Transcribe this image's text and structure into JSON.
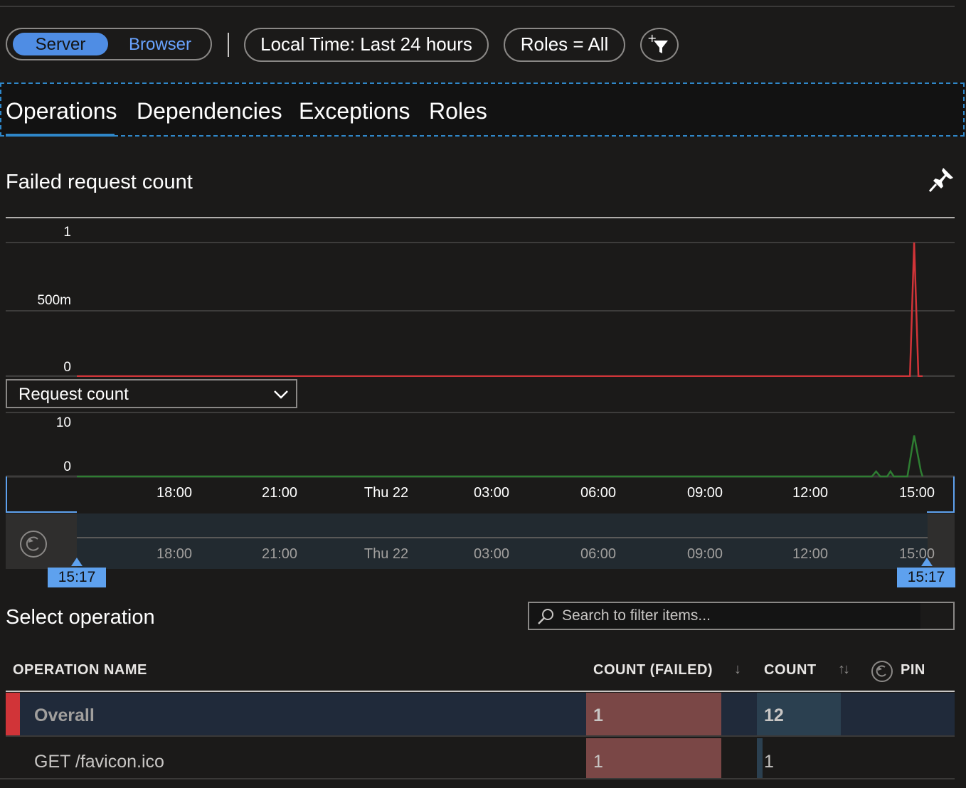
{
  "toolbar": {
    "toggle_active": "Server",
    "toggle_inactive": "Browser",
    "time_filter": "Local Time: Last 24 hours",
    "roles_filter": "Roles = All",
    "add_filter_icon": "add-filter-icon"
  },
  "tabs": [
    {
      "label": "Operations",
      "active": true
    },
    {
      "label": "Dependencies",
      "active": false
    },
    {
      "label": "Exceptions",
      "active": false
    },
    {
      "label": "Roles",
      "active": false
    }
  ],
  "failed_chart": {
    "title": "Failed request count",
    "pin_icon": "pin-icon",
    "line_color": "#d13438"
  },
  "request_chart": {
    "metric_select": "Request count",
    "line_color": "#2e7d32"
  },
  "x_ticks": [
    "18:00",
    "21:00",
    "Thu 22",
    "03:00",
    "06:00",
    "09:00",
    "12:00",
    "15:00"
  ],
  "range": {
    "start_label": "15:17",
    "end_label": "15:17",
    "reset_icon": "reset-zoom-icon"
  },
  "operations": {
    "title": "Select operation",
    "search_placeholder": "Search to filter items...",
    "columns": {
      "name": "OPERATION NAME",
      "count_failed": "COUNT (FAILED)",
      "count": "COUNT",
      "pin": "PIN"
    },
    "rows": [
      {
        "name": "Overall",
        "count_failed": "1",
        "count": "12",
        "failed_fraction": 1.0,
        "count_fraction": 1.0
      },
      {
        "name": "GET /favicon.ico",
        "count_failed": "1",
        "count": "1",
        "failed_fraction": 1.0,
        "count_fraction": 0.083
      }
    ]
  },
  "chart_data": [
    {
      "type": "line",
      "title": "Failed request count",
      "y_ticks": [
        "1",
        "500m",
        "0"
      ],
      "ylim": [
        0,
        1
      ],
      "x_ticks": [
        "18:00",
        "21:00",
        "Thu 22",
        "03:00",
        "06:00",
        "09:00",
        "12:00",
        "15:00"
      ],
      "series": [
        {
          "points": [
            [
              0,
              0
            ],
            [
              0.985,
              0
            ],
            [
              0.99,
              1
            ],
            [
              0.995,
              0
            ],
            [
              1,
              0
            ]
          ]
        }
      ]
    },
    {
      "type": "line",
      "title": "",
      "y_ticks": [
        "10",
        "0"
      ],
      "ylim": [
        0,
        10
      ],
      "x_ticks": [
        "18:00",
        "21:00",
        "Thu 22",
        "03:00",
        "06:00",
        "09:00",
        "12:00",
        "15:00"
      ],
      "series": [
        {
          "points": [
            [
              0,
              0
            ],
            [
              0.94,
              0
            ],
            [
              0.945,
              1
            ],
            [
              0.95,
              0
            ],
            [
              0.958,
              0
            ],
            [
              0.962,
              1
            ],
            [
              0.966,
              0
            ],
            [
              0.982,
              0
            ],
            [
              0.99,
              8
            ],
            [
              0.998,
              1
            ],
            [
              1,
              0
            ]
          ]
        }
      ]
    }
  ]
}
